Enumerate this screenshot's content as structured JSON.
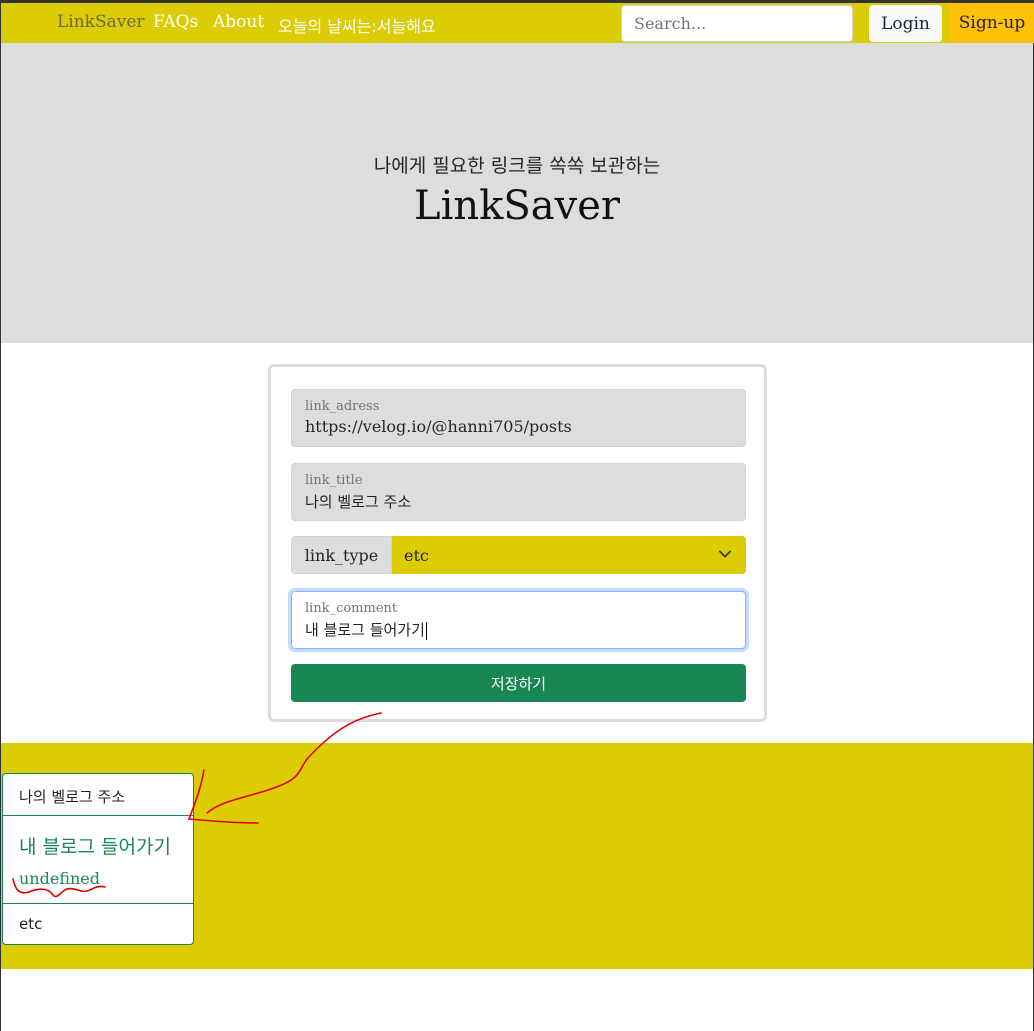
{
  "navbar": {
    "brand": "LinkSaver",
    "links": [
      "FAQs",
      "About",
      "오늘의 날씨는:서늘해요"
    ],
    "search_placeholder": "Search...",
    "login_label": "Login",
    "signup_label": "Sign-up"
  },
  "hero": {
    "subtitle": "나에게 필요한 링크를 쏙쏙 보관하는",
    "title": "LinkSaver"
  },
  "form": {
    "address": {
      "label": "link_adress",
      "value": "https://velog.io/@hanni705/posts"
    },
    "title": {
      "label": "link_title",
      "value": "나의 벨로그 주소"
    },
    "type": {
      "label": "link_type",
      "selected": "etc"
    },
    "comment": {
      "label": "link_comment",
      "value": "내 블로그 들어가기"
    },
    "save_label": "저장하기"
  },
  "card": {
    "header": "나의 벨로그 주소",
    "title": "내 블로그 들어가기",
    "text": "undefined",
    "footer": "etc"
  },
  "colors": {
    "navbar": "#dccc04",
    "signup": "#ffc107",
    "hero": "#dddddd",
    "success": "#198754",
    "annotation": "#e00000"
  },
  "icons": {
    "select_chevron": "chevron-down-icon"
  }
}
